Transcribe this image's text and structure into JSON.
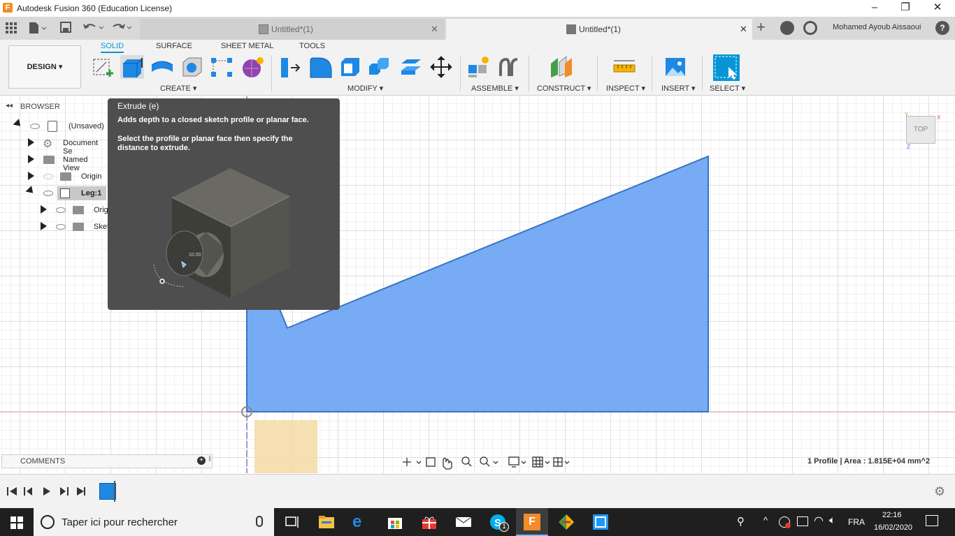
{
  "window": {
    "title": "Autodesk Fusion 360 (Education License)",
    "app_logo_letter": "F"
  },
  "tabs": [
    {
      "label": "Untitled*(1)"
    },
    {
      "label": "Untitled*(1)"
    }
  ],
  "user": {
    "name": "Mohamed Ayoub Aissaoui"
  },
  "toolbar": {
    "design_label": "DESIGN",
    "tabs": [
      "SOLID",
      "SURFACE",
      "SHEET METAL",
      "TOOLS"
    ],
    "groups": [
      "CREATE",
      "MODIFY",
      "ASSEMBLE",
      "CONSTRUCT",
      "INSPECT",
      "INSERT",
      "SELECT"
    ]
  },
  "browser": {
    "header": "BROWSER",
    "items": [
      {
        "label": "(Unsaved)"
      },
      {
        "label": "Document Se"
      },
      {
        "label": "Named View"
      },
      {
        "label": "Origin"
      },
      {
        "label": "Leg:1"
      },
      {
        "label": "Origi"
      },
      {
        "label": "Sket"
      }
    ]
  },
  "tooltip": {
    "title": "Extrude (e)",
    "desc": "Adds depth to a closed sketch profile or planar face.",
    "instructions": "Select the profile or planar face then specify the distance to extrude.",
    "dimension": "10.00"
  },
  "viewcube": {
    "label": "TOP",
    "x_axis": "X",
    "y_axis": "Y",
    "z_axis": "Z"
  },
  "comments": {
    "label": "COMMENTS"
  },
  "status": {
    "text": "1 Profile | Area : 1.815E+04 mm^2"
  },
  "taskbar": {
    "search_placeholder": "Taper ici pour rechercher",
    "language": "FRA",
    "time": "22:16",
    "date": "16/02/2020",
    "skype_badge": "1"
  },
  "colors": {
    "accent": "#0696d7",
    "sketch_fill": "#70a6f2",
    "sketch_edge": "#3a72c7",
    "fusion_orange": "#f28c28"
  }
}
